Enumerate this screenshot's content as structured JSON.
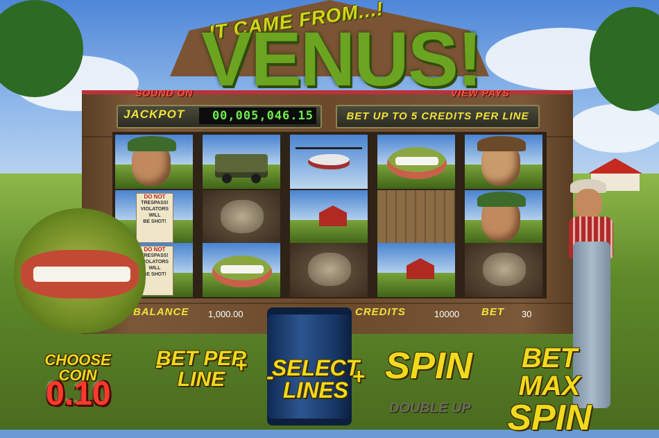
{
  "game": {
    "title_small": "IT CAME FROM...!",
    "title_big": "VENUS!"
  },
  "header": {
    "sound_label": "SOUND ON",
    "view_pays_label": "VIEW PAYS"
  },
  "jackpot": {
    "label": "JACKPOT",
    "value": "00,005,046.15"
  },
  "bet_info": {
    "text": "BET UP TO 5 CREDITS PER LINE"
  },
  "reels": [
    [
      "farmer-face",
      "army-truck",
      "helicopter",
      "venus-mouth",
      "farmer-brown"
    ],
    [
      "no-trespass-sign",
      "rock",
      "red-barn",
      "barn-door",
      "farmer-face"
    ],
    [
      "no-trespass-sign",
      "venus-mouth",
      "rock",
      "red-barn",
      "rock"
    ]
  ],
  "sign_text": {
    "line1": "DO NOT",
    "line2": "TRESPASS!",
    "line3": "VIOLATORS",
    "line4": "WILL",
    "line5": "BE SHOT!"
  },
  "status": {
    "balance_label": "BALANCE",
    "balance_value": "1,000.00",
    "credits_label": "CREDITS",
    "credits_value": "10000",
    "bet_label": "BET",
    "bet_value": "30"
  },
  "controls": {
    "choose_coin_label": "CHOOSE COIN",
    "coin_value": "0.10",
    "bet_per_line_minus": "-",
    "bet_per_line_label1": "BET PER",
    "bet_per_line_label2": "LINE",
    "bet_per_line_plus": "+",
    "select_lines_minus": "-",
    "select_lines_label1": "SELECT",
    "select_lines_label2": "LINES",
    "select_lines_plus": "+",
    "spin_label": "SPIN",
    "double_up_label": "DOUBLE UP",
    "bet_max_label1": "BET MAX",
    "bet_max_label2": "SPIN"
  },
  "colors": {
    "accent_yellow": "#f1d91d",
    "jackpot_green": "#6cf04a",
    "sign_red": "#ff5340",
    "coin_red": "#ff3a2a"
  }
}
